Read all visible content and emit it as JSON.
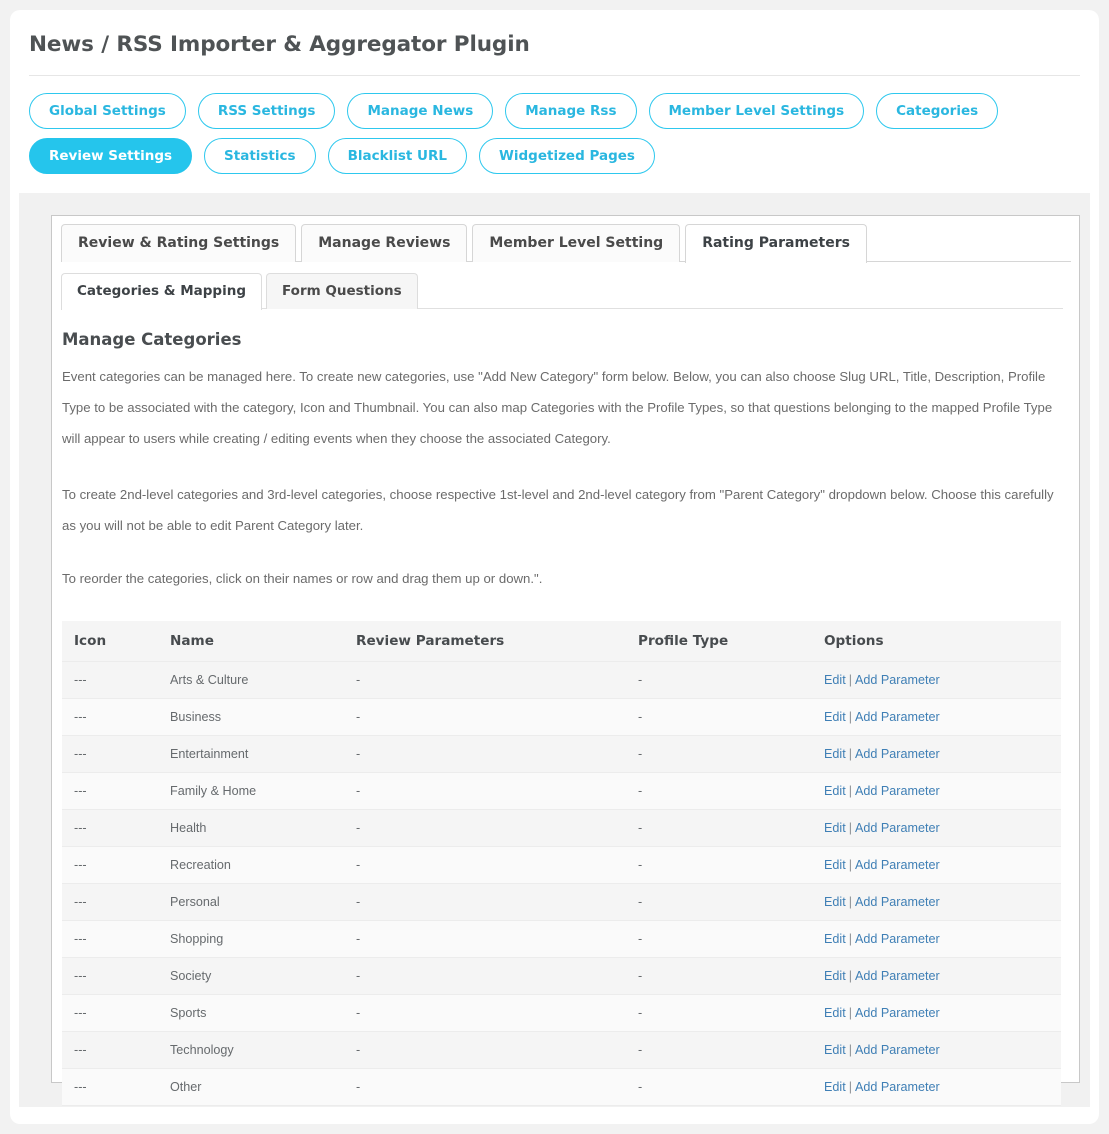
{
  "header": {
    "title": "News / RSS Importer & Aggregator Plugin"
  },
  "pill_nav": {
    "items": [
      {
        "label": "Global Settings",
        "active": false
      },
      {
        "label": "RSS Settings",
        "active": false
      },
      {
        "label": "Manage News",
        "active": false
      },
      {
        "label": "Manage Rss",
        "active": false
      },
      {
        "label": "Member Level Settings",
        "active": false
      },
      {
        "label": "Categories",
        "active": false
      },
      {
        "label": "Review Settings",
        "active": true
      },
      {
        "label": "Statistics",
        "active": false
      },
      {
        "label": "Blacklist URL",
        "active": false
      },
      {
        "label": "Widgetized Pages",
        "active": false
      }
    ],
    "accent_color": "#25c5ec",
    "accent_text_color": "#2ab7e0"
  },
  "tabs_primary": [
    {
      "label": "Review & Rating Settings",
      "active": false
    },
    {
      "label": "Manage Reviews",
      "active": false
    },
    {
      "label": "Member Level Setting",
      "active": false
    },
    {
      "label": "Rating Parameters",
      "active": true
    }
  ],
  "tabs_secondary": [
    {
      "label": "Categories & Mapping",
      "active": true
    },
    {
      "label": "Form Questions",
      "active": false
    }
  ],
  "main": {
    "heading": "Manage Categories",
    "paragraphs": [
      "Event categories can be managed here. To create new categories, use \"Add New Category\" form below. Below, you can also choose Slug URL, Title, Description, Profile Type to be associated with the category, Icon and Thumbnail. You can also map Categories with the Profile Types, so that questions belonging to the mapped Profile Type will appear to users while creating / editing events when they choose the associated Category.",
      "To create 2nd-level categories and 3rd-level categories, choose respective 1st-level and 2nd-level category from \"Parent Category\" dropdown below. Choose this carefully as you will not be able to edit Parent Category later.",
      "To reorder the categories, click on their names or row and drag them up or down.\"."
    ]
  },
  "table": {
    "columns": [
      "Icon",
      "Name",
      "Review Parameters",
      "Profile Type",
      "Options"
    ],
    "option_links": {
      "edit": "Edit",
      "separator": "|",
      "add_parameter": "Add Parameter"
    },
    "link_color": "#3f7fb5",
    "rows": [
      {
        "icon": "---",
        "name": "Arts & Culture",
        "review_parameters": "-",
        "profile_type": "-"
      },
      {
        "icon": "---",
        "name": "Business",
        "review_parameters": "-",
        "profile_type": "-"
      },
      {
        "icon": "---",
        "name": "Entertainment",
        "review_parameters": "-",
        "profile_type": "-"
      },
      {
        "icon": "---",
        "name": "Family & Home",
        "review_parameters": "-",
        "profile_type": "-"
      },
      {
        "icon": "---",
        "name": "Health",
        "review_parameters": "-",
        "profile_type": "-"
      },
      {
        "icon": "---",
        "name": "Recreation",
        "review_parameters": "-",
        "profile_type": "-"
      },
      {
        "icon": "---",
        "name": "Personal",
        "review_parameters": "-",
        "profile_type": "-"
      },
      {
        "icon": "---",
        "name": "Shopping",
        "review_parameters": "-",
        "profile_type": "-"
      },
      {
        "icon": "---",
        "name": "Society",
        "review_parameters": "-",
        "profile_type": "-"
      },
      {
        "icon": "---",
        "name": "Sports",
        "review_parameters": "-",
        "profile_type": "-"
      },
      {
        "icon": "---",
        "name": "Technology",
        "review_parameters": "-",
        "profile_type": "-"
      },
      {
        "icon": "---",
        "name": "Other",
        "review_parameters": "-",
        "profile_type": "-"
      }
    ]
  }
}
